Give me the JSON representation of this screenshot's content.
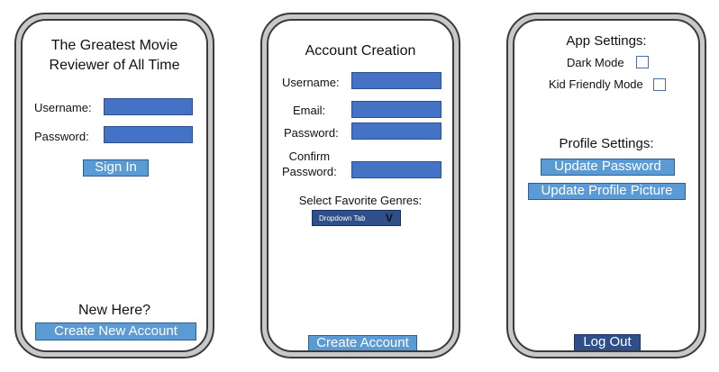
{
  "login_screen": {
    "title_line1": "The Greatest Movie",
    "title_line2": "Reviewer of All Time",
    "username_label": "Username:",
    "password_label": "Password:",
    "sign_in_label": "Sign In",
    "new_here_text": "New Here?",
    "create_new_account_label": "Create New Account"
  },
  "account_creation_screen": {
    "title": "Account Creation",
    "username_label": "Username:",
    "email_label": "Email:",
    "password_label": "Password:",
    "confirm_label_line1": "Confirm",
    "confirm_label_line2": "Password:",
    "genres_label": "Select Favorite Genres:",
    "dropdown_text": "Dropdown Tab",
    "dropdown_arrow": "V",
    "create_account_label": "Create Account"
  },
  "settings_screen": {
    "app_settings_title": "App Settings:",
    "dark_mode_label": "Dark Mode",
    "kid_friendly_label": "Kid Friendly Mode",
    "profile_settings_title": "Profile Settings:",
    "update_password_label": "Update Password",
    "update_picture_label": "Update Profile Picture",
    "log_out_label": "Log Out"
  },
  "colors": {
    "field_blue": "#4472c4",
    "button_blue": "#5b9bd5",
    "button_dark": "#2f4f8a",
    "phone_frame": "#c8c8c8"
  }
}
